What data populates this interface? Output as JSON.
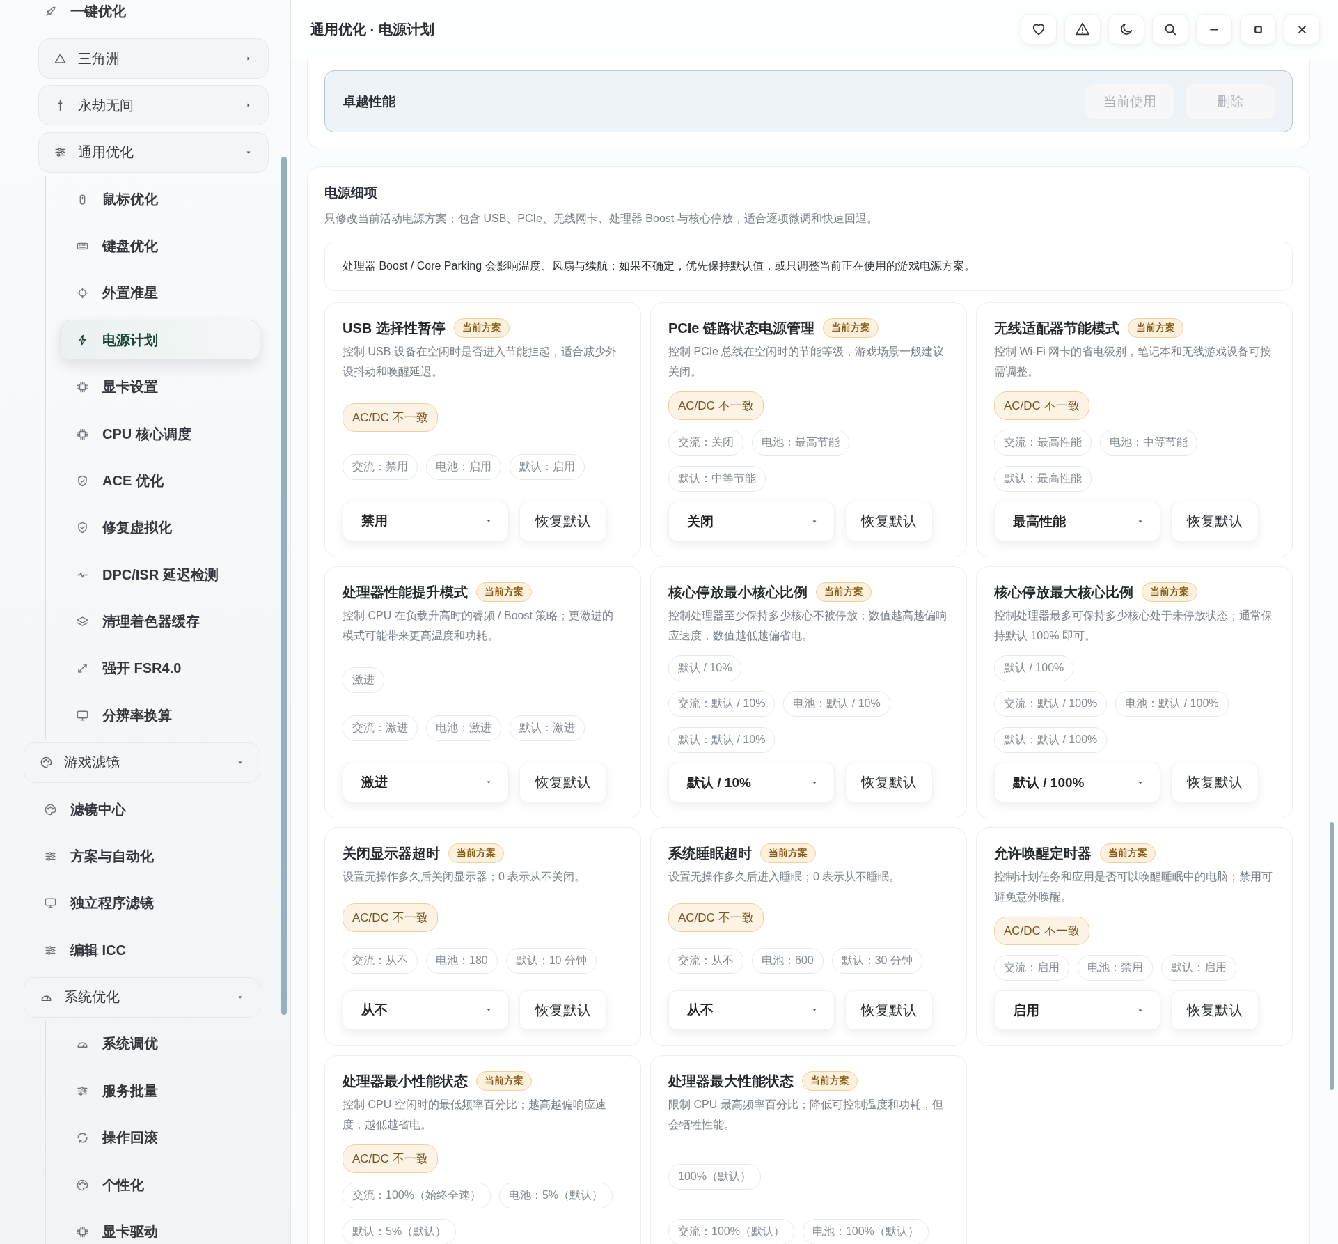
{
  "sidebar": {
    "items": [
      {
        "label": "一键优化",
        "kind": "link",
        "selected": false,
        "children": [
          {
            "label": "三角洲",
            "kind": "group",
            "expanded": false
          },
          {
            "label": "永劫无间",
            "kind": "group",
            "expanded": false
          },
          {
            "label": "通用优化",
            "kind": "group",
            "expanded": true,
            "children": [
              {
                "label": "鼠标优化",
                "kind": "sublink",
                "selected": false
              },
              {
                "label": "键盘优化",
                "kind": "sublink",
                "selected": false
              },
              {
                "label": "外置准星",
                "kind": "sublink",
                "selected": false
              },
              {
                "label": "电源计划",
                "kind": "sublink",
                "selected": true
              },
              {
                "label": "显卡设置",
                "kind": "sublink",
                "selected": false
              },
              {
                "label": "CPU 核心调度",
                "kind": "sublink",
                "selected": false
              },
              {
                "label": "ACE 优化",
                "kind": "sublink",
                "selected": false
              },
              {
                "label": "修复虚拟化",
                "kind": "sublink",
                "selected": false
              },
              {
                "label": "DPC/ISR 延迟检测",
                "kind": "sublink",
                "selected": false
              },
              {
                "label": "清理着色器缓存",
                "kind": "sublink",
                "selected": false
              },
              {
                "label": "强开 FSR4.0",
                "kind": "sublink",
                "selected": false
              },
              {
                "label": "分辨率换算",
                "kind": "sublink",
                "selected": false
              }
            ]
          }
        ]
      },
      {
        "label": "游戏滤镜",
        "kind": "group",
        "expanded": true,
        "children": [
          {
            "label": "滤镜中心",
            "kind": "link",
            "selected": false
          },
          {
            "label": "方案与自动化",
            "kind": "link",
            "selected": false
          },
          {
            "label": "独立程序滤镜",
            "kind": "link",
            "selected": false
          },
          {
            "label": "编辑 ICC",
            "kind": "link",
            "selected": false
          }
        ]
      },
      {
        "label": "系统优化",
        "kind": "group",
        "expanded": true,
        "children": [
          {
            "label": "系统调优",
            "kind": "sublink",
            "selected": false
          },
          {
            "label": "服务批量",
            "kind": "sublink",
            "selected": false
          },
          {
            "label": "操作回滚",
            "kind": "sublink",
            "selected": false
          },
          {
            "label": "个性化",
            "kind": "sublink",
            "selected": false
          },
          {
            "label": "显卡驱动",
            "kind": "sublink",
            "selected": false
          }
        ]
      }
    ]
  },
  "header": {
    "title": "通用优化 · 电源计划"
  },
  "plan": {
    "name": "卓越性能",
    "buttons": [
      {
        "label": "当前使用",
        "disabled": true
      },
      {
        "label": "删除",
        "disabled": true
      }
    ]
  },
  "details": {
    "title": "电源细项",
    "description": "只修改当前活动电源方案；包含 USB、PCIe、无线网卡、处理器 Boost 与核心停放，适合逐项微调和快速回退。",
    "note": "处理器 Boost / Core Parking 会影响温度、风扇与续航；如果不确定，优先保持默认值，或只调整当前正在使用的游戏电源方案。",
    "cards": [
      {
        "title": "USB 选择性暂停",
        "badge": "当前方案",
        "description": "控制 USB 设备在空闲时是否进入节能挂起，适合减少外设抖动和唤醒延迟。",
        "status": {
          "text": "AC/DC 不一致",
          "kind": "mismatch"
        },
        "chips": [
          "交流：禁用",
          "电池：启用",
          "默认：启用"
        ],
        "select": "禁用",
        "reset": "恢复默认"
      },
      {
        "title": "PCIe 链路状态电源管理",
        "badge": "当前方案",
        "description": "控制 PCIe 总线在空闲时的节能等级，游戏场景一般建议关闭。",
        "status": {
          "text": "AC/DC 不一致",
          "kind": "mismatch"
        },
        "chips": [
          "交流：关闭",
          "电池：最高节能",
          "默认：中等节能"
        ],
        "select": "关闭",
        "reset": "恢复默认"
      },
      {
        "title": "无线适配器节能模式",
        "badge": "当前方案",
        "description": "控制 Wi-Fi 网卡的省电级别，笔记本和无线游戏设备可按需调整。",
        "status": {
          "text": "AC/DC 不一致",
          "kind": "mismatch"
        },
        "chips": [
          "交流：最高性能",
          "电池：中等节能",
          "默认：最高性能"
        ],
        "select": "最高性能",
        "reset": "恢复默认"
      },
      {
        "title": "处理器性能提升模式",
        "badge": "当前方案",
        "description": "控制 CPU 在负载升高时的睿频 / Boost 策略；更激进的模式可能带来更高温度和功耗。",
        "status": {
          "text": "激进",
          "kind": "value"
        },
        "chips": [
          "交流：激进",
          "电池：激进",
          "默认：激进"
        ],
        "select": "激进",
        "reset": "恢复默认"
      },
      {
        "title": "核心停放最小核心比例",
        "badge": "当前方案",
        "description": "控制处理器至少保持多少核心不被停放；数值越高越偏响应速度，数值越低越偏省电。",
        "status": {
          "text": "默认 / 10%",
          "kind": "value"
        },
        "chips": [
          "交流：默认 / 10%",
          "电池：默认 / 10%",
          "默认：默认 / 10%"
        ],
        "select": "默认 / 10%",
        "reset": "恢复默认"
      },
      {
        "title": "核心停放最大核心比例",
        "badge": "当前方案",
        "description": "控制处理器最多可保持多少核心处于未停放状态；通常保持默认 100% 即可。",
        "status": {
          "text": "默认 / 100%",
          "kind": "value"
        },
        "chips": [
          "交流：默认 / 100%",
          "电池：默认 / 100%",
          "默认：默认 / 100%"
        ],
        "select": "默认 / 100%",
        "reset": "恢复默认"
      },
      {
        "title": "关闭显示器超时",
        "badge": "当前方案",
        "description": "设置无操作多久后关闭显示器；0 表示从不关闭。",
        "status": {
          "text": "AC/DC 不一致",
          "kind": "mismatch"
        },
        "chips": [
          "交流：从不",
          "电池：180",
          "默认：10 分钟"
        ],
        "select": "从不",
        "reset": "恢复默认"
      },
      {
        "title": "系统睡眠超时",
        "badge": "当前方案",
        "description": "设置无操作多久后进入睡眠；0 表示从不睡眠。",
        "status": {
          "text": "AC/DC 不一致",
          "kind": "mismatch"
        },
        "chips": [
          "交流：从不",
          "电池：600",
          "默认：30 分钟"
        ],
        "select": "从不",
        "reset": "恢复默认"
      },
      {
        "title": "允许唤醒定时器",
        "badge": "当前方案",
        "description": "控制计划任务和应用是否可以唤醒睡眠中的电脑；禁用可避免意外唤醒。",
        "status": {
          "text": "AC/DC 不一致",
          "kind": "mismatch"
        },
        "chips": [
          "交流：启用",
          "电池：禁用",
          "默认：启用"
        ],
        "select": "启用",
        "reset": "恢复默认"
      },
      {
        "title": "处理器最小性能状态",
        "badge": "当前方案",
        "description": "控制 CPU 空闲时的最低频率百分比；越高越偏响应速度，越低越省电。",
        "status": {
          "text": "AC/DC 不一致",
          "kind": "mismatch"
        },
        "chips": [
          "交流：100%（始终全速）",
          "电池：5%（默认）",
          "默认：5%（默认）"
        ]
      },
      {
        "title": "处理器最大性能状态",
        "badge": "当前方案",
        "description": "限制 CPU 最高频率百分比；降低可控制温度和功耗，但会牺牲性能。",
        "status": {
          "text": "100%（默认）",
          "kind": "value"
        },
        "chips": [
          "交流：100%（默认）",
          "电池：100%（默认）"
        ]
      }
    ]
  }
}
